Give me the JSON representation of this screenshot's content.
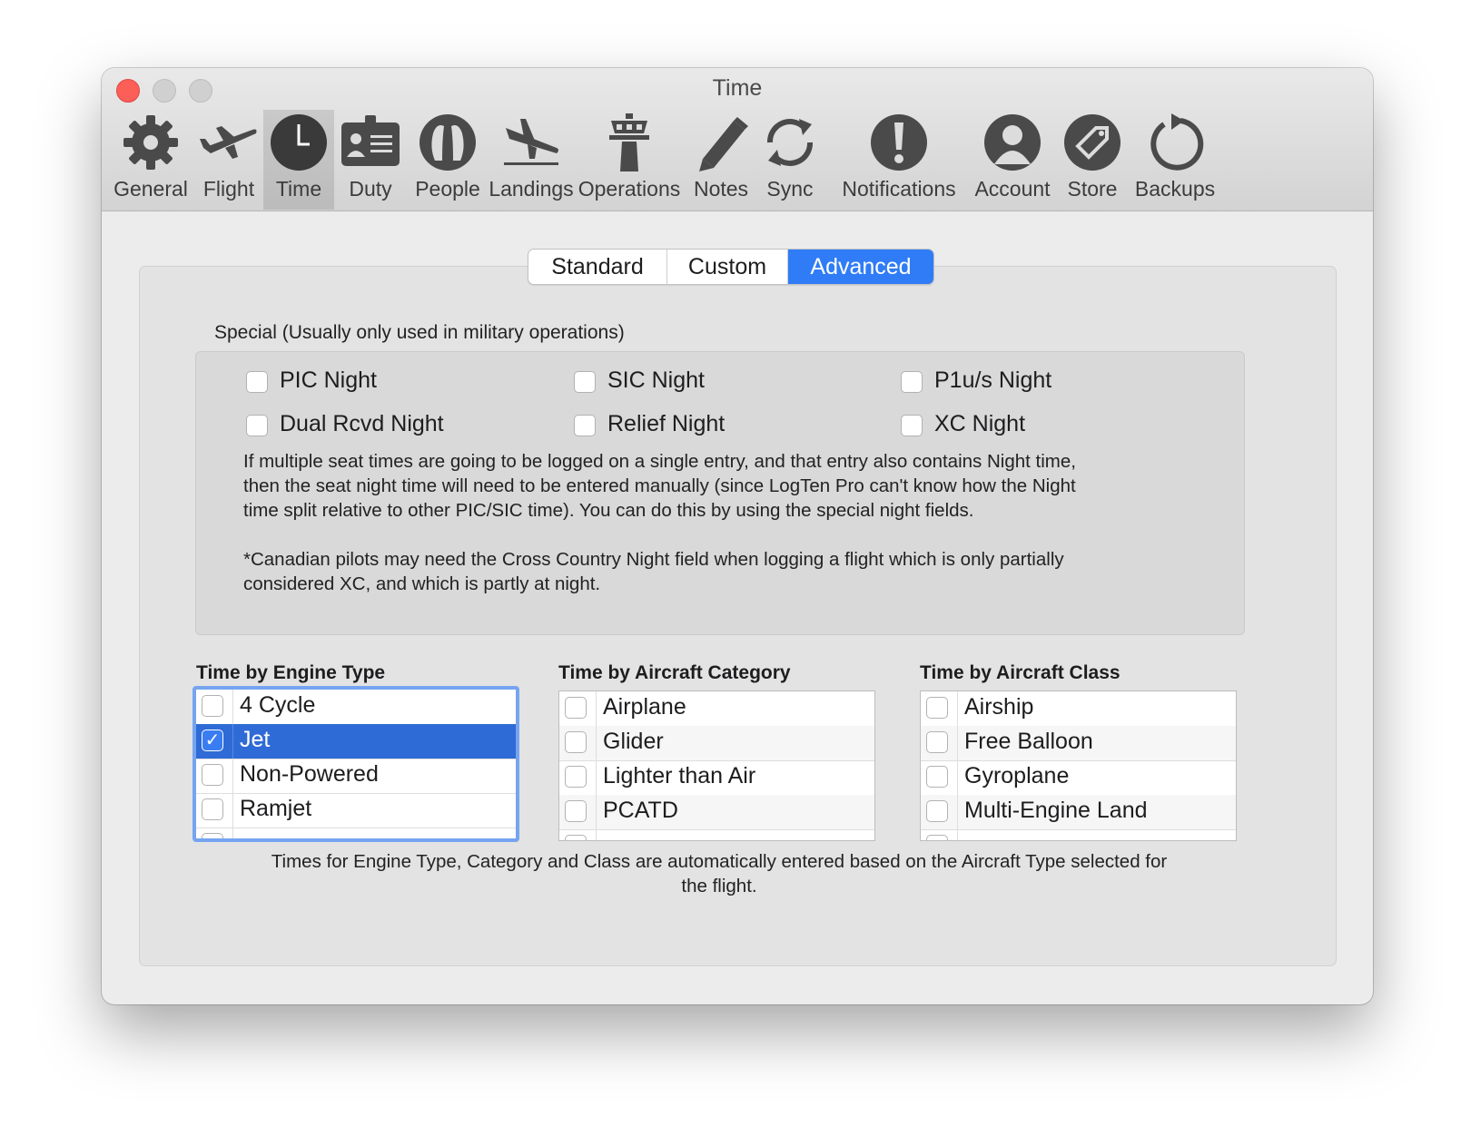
{
  "window": {
    "title": "Time"
  },
  "toolbar": [
    {
      "label": "General",
      "icon": "gear-icon"
    },
    {
      "label": "Flight",
      "icon": "airplane-icon"
    },
    {
      "label": "Time",
      "icon": "clock-icon",
      "selected": true
    },
    {
      "label": "Duty",
      "icon": "id-badge-icon"
    },
    {
      "label": "People",
      "icon": "people-icon"
    },
    {
      "label": "Landings",
      "icon": "landing-plane-icon"
    },
    {
      "label": "Operations",
      "icon": "control-tower-icon"
    },
    {
      "label": "Notes",
      "icon": "pencil-icon"
    },
    {
      "label": "Sync",
      "icon": "sync-arrows-icon"
    },
    {
      "label": "Notifications",
      "icon": "exclamation-icon"
    },
    {
      "label": "Account",
      "icon": "person-icon"
    },
    {
      "label": "Store",
      "icon": "tag-icon"
    },
    {
      "label": "Backups",
      "icon": "refresh-icon"
    }
  ],
  "tabs": [
    {
      "label": "Standard",
      "active": false
    },
    {
      "label": "Custom",
      "active": false
    },
    {
      "label": "Advanced",
      "active": true
    }
  ],
  "special": {
    "label": "Special (Usually only used in military operations)",
    "options": [
      {
        "label": "PIC Night",
        "checked": false
      },
      {
        "label": "SIC Night",
        "checked": false
      },
      {
        "label": "P1u/s Night",
        "checked": false
      },
      {
        "label": "Dual Rcvd Night",
        "checked": false
      },
      {
        "label": "Relief Night",
        "checked": false
      },
      {
        "label": "XC Night",
        "checked": false
      }
    ],
    "description_1_line_1": "If multiple seat times are going to be logged on a single entry, and that entry also contains Night time,",
    "description_1_line_2": "then the seat night time will need to be entered manually (since LogTen Pro can't know how the Night",
    "description_1_line_3": "time split relative to other PIC/SIC time). You can do this by using the special night fields.",
    "description_2_line_1": "*Canadian pilots may need the Cross Country Night field when logging a flight which is only partially",
    "description_2_line_2": "considered XC, and which is partly at night."
  },
  "engine_type": {
    "title": "Time by Engine Type",
    "items": [
      {
        "label": "4 Cycle",
        "checked": false
      },
      {
        "label": "Jet",
        "checked": true,
        "selected": true
      },
      {
        "label": "Non-Powered",
        "checked": false
      },
      {
        "label": "Ramjet",
        "checked": false
      }
    ]
  },
  "aircraft_category": {
    "title": "Time by Aircraft Category",
    "items": [
      {
        "label": "Airplane",
        "checked": false
      },
      {
        "label": "Glider",
        "checked": false
      },
      {
        "label": "Lighter than Air",
        "checked": false
      },
      {
        "label": "PCATD",
        "checked": false
      }
    ]
  },
  "aircraft_class": {
    "title": "Time by Aircraft Class",
    "items": [
      {
        "label": "Airship",
        "checked": false
      },
      {
        "label": "Free Balloon",
        "checked": false
      },
      {
        "label": "Gyroplane",
        "checked": false
      },
      {
        "label": "Multi-Engine Land",
        "checked": false
      }
    ]
  },
  "footer_note_line_1": "Times for Engine Type, Category and Class are automatically entered based on the Aircraft Type selected for",
  "footer_note_line_2": "the flight.",
  "colors": {
    "accent": "#2f7cf6",
    "selected_row": "#2f6bd6",
    "close_button": "#fc5f57"
  }
}
